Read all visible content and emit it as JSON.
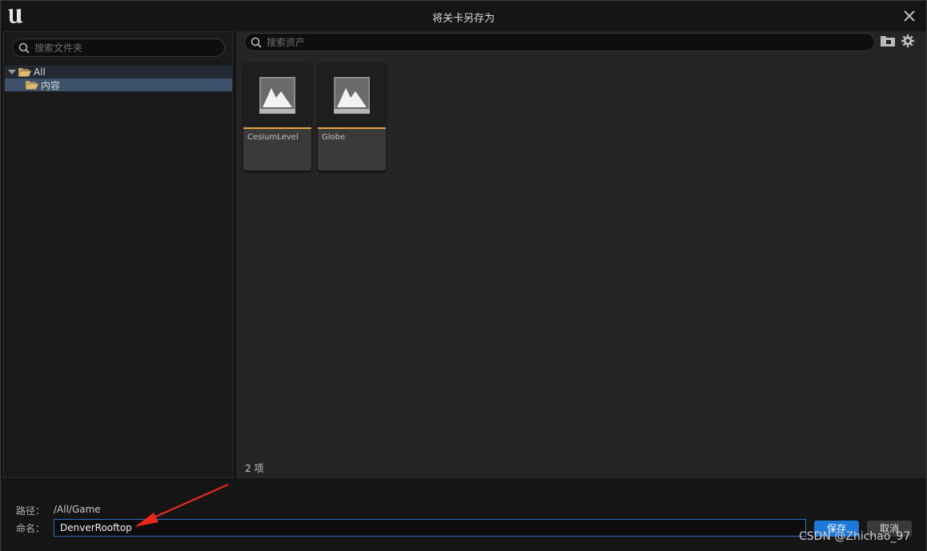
{
  "window": {
    "title": "将关卡另存为",
    "logo": "unreal-engine-logo"
  },
  "left_panel": {
    "search_placeholder": "搜索文件夹",
    "tree": {
      "root_label": "All",
      "child_label": "内容"
    }
  },
  "right_panel": {
    "search_placeholder": "搜索资产",
    "icons": [
      "folder-icon",
      "gear-icon"
    ],
    "assets": [
      {
        "name": "CesiumLevel",
        "icon": "level-icon"
      },
      {
        "name": "Globe",
        "icon": "level-icon"
      }
    ],
    "count_label": "2 项"
  },
  "bottom": {
    "path_label": "路径：",
    "path_value": "/All/Game",
    "name_label": "命名：",
    "name_value": "DenverRooftop",
    "save_label": "保存",
    "cancel_label": "取消"
  },
  "watermark": "CSDN @Zhichao_97",
  "colors": {
    "accent_blue": "#1e78d8",
    "asset_bar": "#e8a33d",
    "selection": "#3c5069",
    "annotation_arrow": "#e8281e"
  }
}
